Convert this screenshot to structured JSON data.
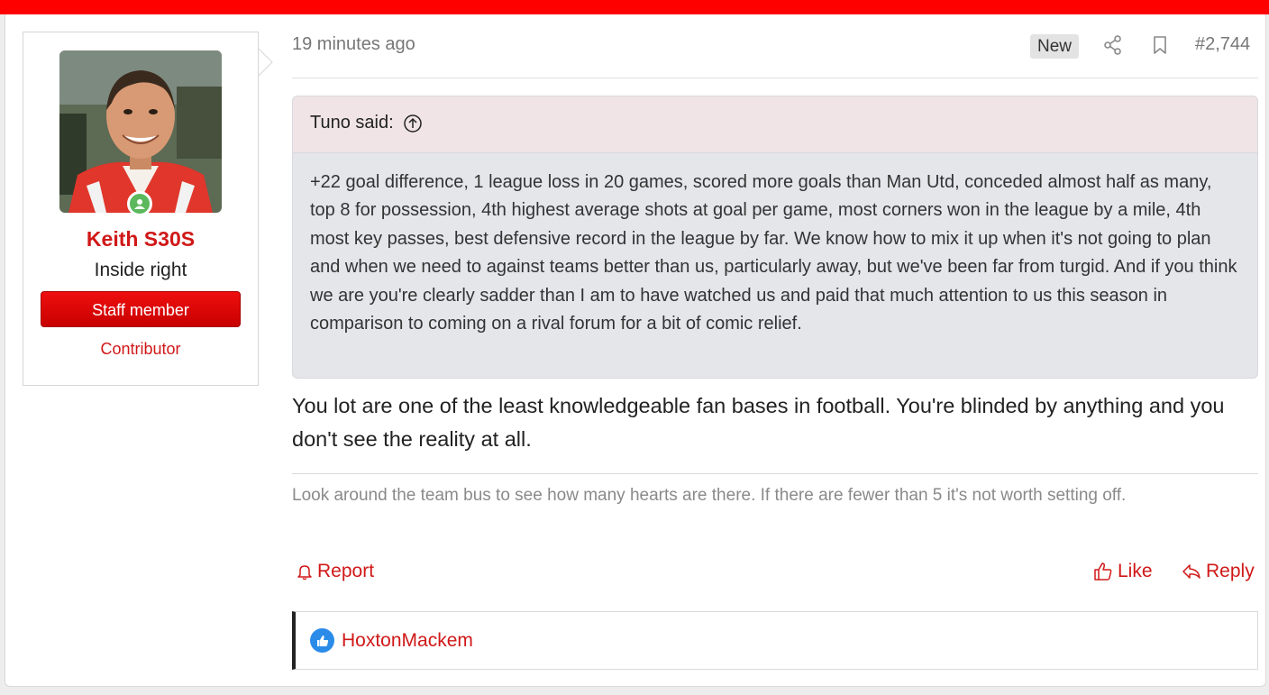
{
  "user": {
    "name": "Keith S30S",
    "title": "Inside right",
    "staff_label": "Staff member",
    "banner": "Contributor"
  },
  "post": {
    "time": "19 minutes ago",
    "new_label": "New",
    "number": "#2,744",
    "quote": {
      "author_label": "Tuno said:",
      "text": "+22 goal difference, 1 league loss in 20 games, scored more goals than Man Utd, conceded almost half as many, top 8 for possession, 4th highest average shots at goal per game, most corners won in the league by a mile, 4th most key passes, best defensive record in the league by far. We know how to mix it up when it's not going to plan and when we need to against teams better than us, particularly away, but we've been far from turgid. And if you think we are you're clearly sadder than I am to have watched us and paid that much attention to us this season in comparison to coming on a rival forum for a bit of comic relief."
    },
    "message": "You lot are one of the least knowledgeable fan bases in football. You're blinded by anything and you don't see the reality at all.",
    "signature": "Look around the team bus to see how many hearts are there. If there are fewer than 5 it's not worth setting off."
  },
  "actions": {
    "report": "Report",
    "like": "Like",
    "reply": "Reply"
  },
  "reactions": {
    "users": "HoxtonMackem"
  },
  "colors": {
    "accent": "#d01818",
    "topbar": "#ff0000",
    "online": "#5cb85c",
    "like_badge": "#2b8be8"
  },
  "icons": [
    "share-icon",
    "bookmark-icon",
    "arrow-up-circle-icon",
    "bell-icon",
    "thumbs-up-icon",
    "reply-icon",
    "online-person-icon"
  ]
}
